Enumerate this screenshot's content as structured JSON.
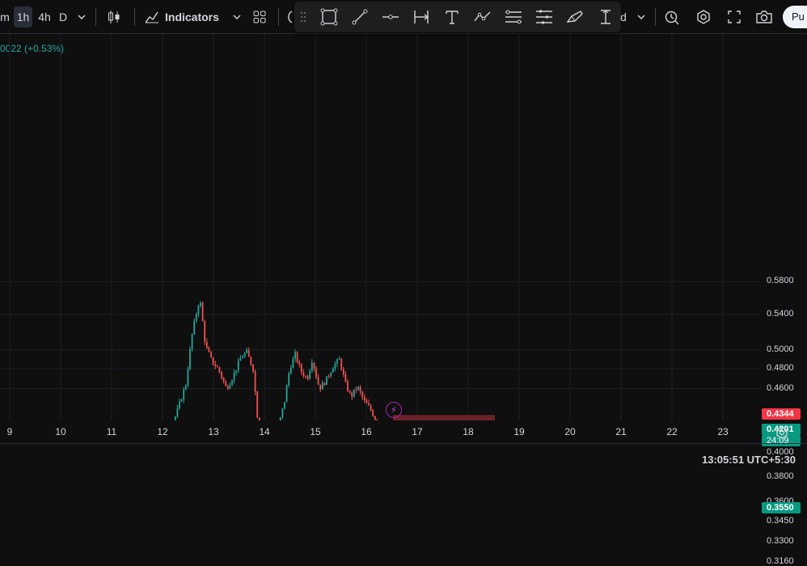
{
  "toolbar": {
    "timeframes": [
      "m",
      "1h",
      "4h",
      "D"
    ],
    "active_timeframe": "1h",
    "indicators_label": "Indicators",
    "truncated_text": "d",
    "publish_label": "Pu"
  },
  "legend": {
    "change": "0022 (+0.53%)"
  },
  "price_axis": {
    "labels": [
      "0.5800",
      "0.5400",
      "0.5000",
      "0.4800",
      "0.4600",
      "0.4000",
      "0.3800",
      "0.3600",
      "0.3450",
      "0.3300",
      "0.3160"
    ],
    "stop_loss_tag": "0.4344",
    "entry_tag": "0.4202",
    "last_price_tag": "0.4201",
    "countdown": "24:09",
    "take_profit_tag": "0.3550"
  },
  "time_axis": {
    "labels": [
      "9",
      "10",
      "11",
      "12",
      "13",
      "14",
      "15",
      "16",
      "17",
      "18",
      "19",
      "20",
      "21",
      "22",
      "23"
    ]
  },
  "status_bar": {
    "clock": "13:05:51 UTC+5:30"
  },
  "colors": {
    "up": "#26a69a",
    "down": "#ef5350",
    "background": "#0f0f0f",
    "grid": "#1c1f26",
    "stop_zone": "#6b2228",
    "target_zone": "#10312c",
    "tag_stop": "#f23645",
    "tag_entry": "#787b86",
    "tag_last": "#089981"
  },
  "chart_data": {
    "type": "candlestick",
    "y_scale": "log",
    "position": {
      "side": "short",
      "entry": 0.4202,
      "stop": 0.4344,
      "target": 0.355
    },
    "last_price": 0.4201
  }
}
